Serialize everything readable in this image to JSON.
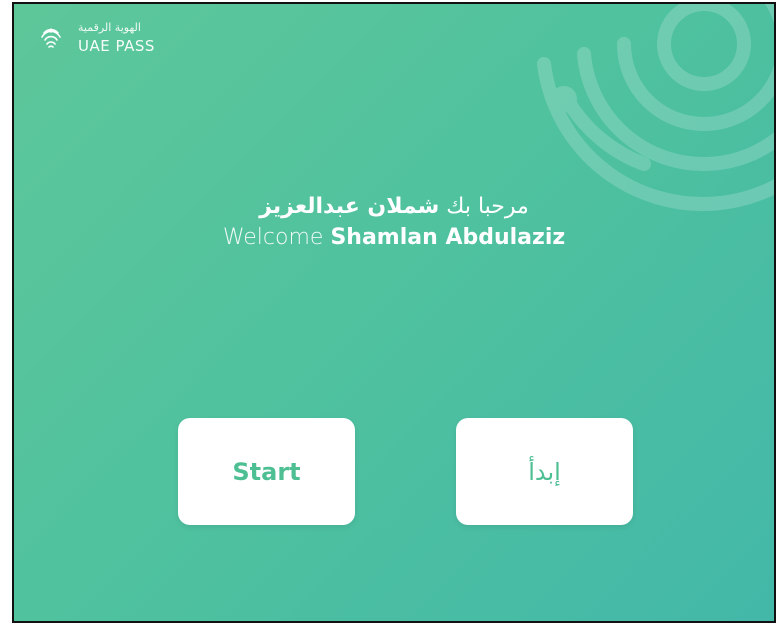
{
  "brand": {
    "name_ar": "الهوية الرقمية",
    "name_en": "UAE PASS",
    "logo_icon": "fingerprint-logo-icon"
  },
  "welcome": {
    "greeting_ar": "مرحبا بك",
    "name_ar": "شملان عبدالعزيز",
    "greeting_en": "Welcome",
    "name_en": "Shamlan Abdulaziz"
  },
  "actions": {
    "start_en": "Start",
    "start_ar": "إبدأ"
  },
  "colors": {
    "background_start": "#5ec79a",
    "background_end": "#43b8a8",
    "button_bg": "#ffffff",
    "button_text": "#4dbf93"
  }
}
